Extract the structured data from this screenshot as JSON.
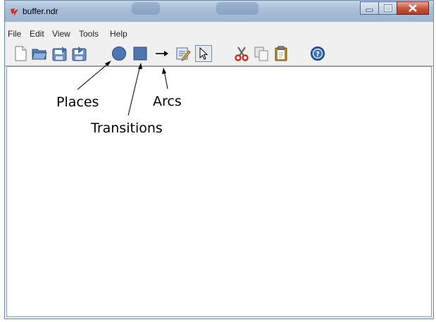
{
  "window": {
    "title": "buffer.ndr",
    "app_icon": "tk-feather-icon",
    "controls": [
      "minimize-icon",
      "maximize-icon",
      "close-icon"
    ]
  },
  "menu": {
    "items": [
      "File",
      "Edit",
      "View",
      "Tools",
      "Help"
    ]
  },
  "toolbar": {
    "buttons": [
      "new-file-icon",
      "open-folder-icon",
      "save-icon",
      "save-as-icon",
      "place-circle-icon",
      "transition-square-icon",
      "arc-arrow-icon",
      "edit-pencil-icon",
      "select-pointer-icon",
      "cut-scissors-icon",
      "copy-icon",
      "paste-icon",
      "help-icon"
    ],
    "selected": "select-pointer-icon"
  },
  "annotations": {
    "places": "Places",
    "transitions": "Transitions",
    "arcs": "Arcs"
  },
  "colors": {
    "titlebar": "#a9bfd8",
    "close_button": "#c7523b",
    "place_fill": "#4f76b0",
    "transition_fill": "#4f76b0",
    "help_icon": "#2c5fb0",
    "scissors": "#c83020"
  }
}
